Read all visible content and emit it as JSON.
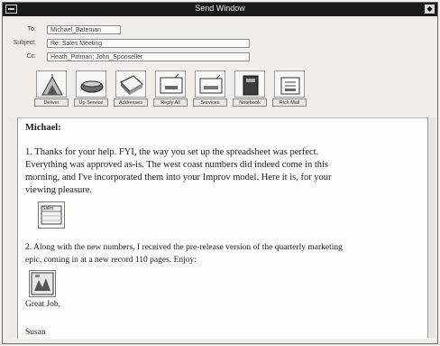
{
  "window": {
    "title": "Send Window"
  },
  "header": {
    "to_label": "To:",
    "to_value": "Michael_Bateman",
    "subject_label": "Subject:",
    "subject_value": "Re: Sales Meeting",
    "cc_label": "Cc:",
    "cc_value": "Heath_Pittman; John_Sponseller"
  },
  "toolbar": [
    {
      "label": "Deliver",
      "icon": "deliver-icon"
    },
    {
      "label": "Up Service",
      "icon": "up-service-icon"
    },
    {
      "label": "Addresses",
      "icon": "addresses-icon"
    },
    {
      "label": "Reply All",
      "icon": "reply-all-icon"
    },
    {
      "label": "Services",
      "icon": "services-icon"
    },
    {
      "label": "Notebook",
      "icon": "notebook-icon"
    },
    {
      "label": "Rich Mail",
      "icon": "rich-mail-icon"
    }
  ],
  "message": {
    "greeting": "Michael:",
    "para1_line1": "1.  Thanks for your help. FYI, the way you set up the spreadsheet was perfect.",
    "para1_line2": "Everything was approved as-is. The west coast numbers did indeed come in this",
    "para1_line3": "morning, and I've incorporated them into your Improv model. Here it is, for your",
    "para1_line4": "viewing pleasure.",
    "attachment1_label": "Sales",
    "para2_line1": "2. Along with the new numbers, I received the pre-release version of the quarterly marketing",
    "para2_line2": "epic, coming in at a new record 110 pages. Enjoy:",
    "closing": "Great Job,",
    "signature": "Susan"
  }
}
